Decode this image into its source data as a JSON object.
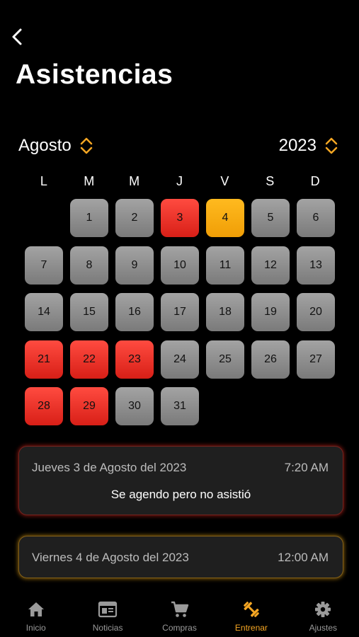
{
  "title": "Asistencias",
  "colors": {
    "accent": "#f5a623",
    "missed": "#e8291f",
    "attended": "#f7aa12",
    "day": "#8e8e8e"
  },
  "month_selector": {
    "value": "Agosto",
    "icon": "chevron-up-down-icon"
  },
  "year_selector": {
    "value": "2023",
    "icon": "chevron-up-down-icon"
  },
  "weekdays": [
    "L",
    "M",
    "M",
    "J",
    "V",
    "S",
    "D"
  ],
  "calendar": {
    "leading_blank_days": 1,
    "days": [
      {
        "day": "1",
        "status": "none"
      },
      {
        "day": "2",
        "status": "none"
      },
      {
        "day": "3",
        "status": "missed"
      },
      {
        "day": "4",
        "status": "attended"
      },
      {
        "day": "5",
        "status": "none"
      },
      {
        "day": "6",
        "status": "none"
      },
      {
        "day": "7",
        "status": "none"
      },
      {
        "day": "8",
        "status": "none"
      },
      {
        "day": "9",
        "status": "none"
      },
      {
        "day": "10",
        "status": "none"
      },
      {
        "day": "11",
        "status": "none"
      },
      {
        "day": "12",
        "status": "none"
      },
      {
        "day": "13",
        "status": "none"
      },
      {
        "day": "14",
        "status": "none"
      },
      {
        "day": "15",
        "status": "none"
      },
      {
        "day": "16",
        "status": "none"
      },
      {
        "day": "17",
        "status": "none"
      },
      {
        "day": "18",
        "status": "none"
      },
      {
        "day": "19",
        "status": "none"
      },
      {
        "day": "20",
        "status": "none"
      },
      {
        "day": "21",
        "status": "missed"
      },
      {
        "day": "22",
        "status": "missed"
      },
      {
        "day": "23",
        "status": "missed"
      },
      {
        "day": "24",
        "status": "none"
      },
      {
        "day": "25",
        "status": "none"
      },
      {
        "day": "26",
        "status": "none"
      },
      {
        "day": "27",
        "status": "none"
      },
      {
        "day": "28",
        "status": "missed"
      },
      {
        "day": "29",
        "status": "missed"
      },
      {
        "day": "30",
        "status": "none"
      },
      {
        "day": "31",
        "status": "none"
      }
    ]
  },
  "records": [
    {
      "date": "Jueves 3 de Agosto del 2023",
      "time": "7:20 AM",
      "status": "Se agendo pero no asistió"
    },
    {
      "date": "Viernes 4 de Agosto del 2023",
      "time": "12:00 AM"
    }
  ],
  "tabs": [
    {
      "label": "Inicio",
      "icon": "home-icon"
    },
    {
      "label": "Noticias",
      "icon": "newspaper-icon"
    },
    {
      "label": "Compras",
      "icon": "cart-icon"
    },
    {
      "label": "Entrenar",
      "icon": "dumbbell-icon",
      "active": true
    },
    {
      "label": "Ajustes",
      "icon": "gear-icon"
    }
  ]
}
